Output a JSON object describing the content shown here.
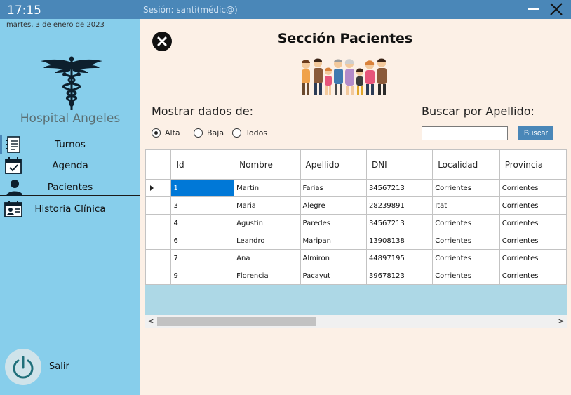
{
  "header": {
    "clock": "17:15",
    "session": "Sesión: santi(médic@)"
  },
  "sidebar": {
    "date": "martes, 3 de enero de 2023",
    "hospital_name": "Hospital Angeles",
    "items": [
      {
        "label": "Turnos",
        "icon": "notepad-icon"
      },
      {
        "label": "Agenda",
        "icon": "calendar-check-icon"
      },
      {
        "label": "Pacientes",
        "icon": "user-icon",
        "active": true
      },
      {
        "label": "Historia Clínica",
        "icon": "medical-id-card-icon"
      }
    ],
    "exit_label": "Salir"
  },
  "main": {
    "title": "Sección Pacientes",
    "filter_label": "Mostrar dados de:",
    "radios": [
      {
        "label": "Alta",
        "checked": true
      },
      {
        "label": "Baja",
        "checked": false
      },
      {
        "label": "Todos",
        "checked": false
      }
    ],
    "search_label": "Buscar por Apellido:",
    "search_value": "",
    "search_button": "Buscar"
  },
  "table": {
    "columns": [
      "Id",
      "Nombre",
      "Apellido",
      "DNI",
      "Localidad",
      "Provincia"
    ],
    "rows": [
      [
        "1",
        "Martin",
        "Farias",
        "34567213",
        "Corrientes",
        "Corrientes"
      ],
      [
        "3",
        "Maria",
        "Alegre",
        "28239891",
        "Itati",
        "Corrientes"
      ],
      [
        "4",
        "Agustin",
        "Paredes",
        "34567213",
        "Corrientes",
        "Corrientes"
      ],
      [
        "6",
        "Leandro",
        "Maripan",
        "13908138",
        "Corrientes",
        "Corrientes"
      ],
      [
        "7",
        "Ana",
        "Almiron",
        "44897195",
        "Corrientes",
        "Corrientes"
      ],
      [
        "9",
        "Florencia",
        "Pacayut",
        "39678123",
        "Corrientes",
        "Corrientes"
      ]
    ],
    "selected_row": 0
  },
  "colors": {
    "topbar": "#4a87b8",
    "sidebar": "#87ceeb",
    "main_bg": "#fcf0e6",
    "selection": "#0078d7"
  }
}
